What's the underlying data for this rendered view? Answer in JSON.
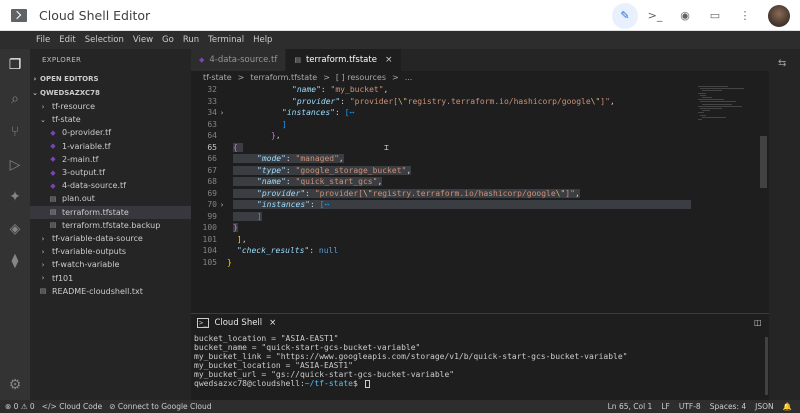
{
  "titlebar": {
    "title": "Cloud Shell Editor",
    "actions": [
      {
        "name": "edit-icon",
        "glyph": "✎"
      },
      {
        "name": "terminal-icon",
        "glyph": ">_"
      },
      {
        "name": "preview-icon",
        "glyph": "◉"
      },
      {
        "name": "layout-icon",
        "glyph": "▭"
      },
      {
        "name": "more-icon",
        "glyph": "⋮"
      }
    ]
  },
  "menubar": [
    "File",
    "Edit",
    "Selection",
    "View",
    "Go",
    "Run",
    "Terminal",
    "Help"
  ],
  "sidebar": {
    "title": "EXPLORER",
    "sections": {
      "open_editors": "OPEN EDITORS",
      "workspace": "QWEDSAZXC78"
    },
    "tree": [
      {
        "label": "tf-resource",
        "kind": "folder",
        "open": false,
        "indent": 1
      },
      {
        "label": "tf-state",
        "kind": "folder",
        "open": true,
        "indent": 1
      },
      {
        "label": "0-provider.tf",
        "kind": "tf",
        "indent": 2
      },
      {
        "label": "1-variable.tf",
        "kind": "tf",
        "indent": 2
      },
      {
        "label": "2-main.tf",
        "kind": "tf",
        "indent": 2
      },
      {
        "label": "3-output.tf",
        "kind": "tf",
        "indent": 2
      },
      {
        "label": "4-data-source.tf",
        "kind": "tf",
        "indent": 2
      },
      {
        "label": "plan.out",
        "kind": "plain",
        "indent": 2
      },
      {
        "label": "terraform.tfstate",
        "kind": "plain",
        "indent": 2,
        "selected": true
      },
      {
        "label": "terraform.tfstate.backup",
        "kind": "plain",
        "indent": 2
      },
      {
        "label": "tf-variable-data-source",
        "kind": "folder",
        "open": false,
        "indent": 1
      },
      {
        "label": "tf-variable-outputs",
        "kind": "folder",
        "open": false,
        "indent": 1
      },
      {
        "label": "tf-watch-variable",
        "kind": "folder",
        "open": false,
        "indent": 1
      },
      {
        "label": "tf101",
        "kind": "folder",
        "open": false,
        "indent": 1
      },
      {
        "label": "README-cloudshell.txt",
        "kind": "plain",
        "indent": 1
      }
    ]
  },
  "tabs": [
    {
      "label": "4-data-source.tf",
      "active": false
    },
    {
      "label": "terraform.tfstate",
      "active": true,
      "close": "×"
    }
  ],
  "breadcrumb": [
    "tf-state",
    ">",
    "terraform.tfstate",
    ">",
    "[ ] resources",
    ">",
    "..."
  ],
  "editor": {
    "lines": [
      {
        "n": "32",
        "fold": "",
        "sel": false
      },
      {
        "n": "33",
        "fold": "",
        "sel": false
      },
      {
        "n": "34",
        "fold": "›",
        "sel": false
      },
      {
        "n": "63",
        "fold": "",
        "sel": false
      },
      {
        "n": "64",
        "fold": "",
        "sel": false
      },
      {
        "n": "65",
        "fold": "",
        "sel": true,
        "current": true
      },
      {
        "n": "66",
        "fold": "",
        "sel": true
      },
      {
        "n": "67",
        "fold": "",
        "sel": true
      },
      {
        "n": "68",
        "fold": "",
        "sel": true
      },
      {
        "n": "69",
        "fold": "",
        "sel": true
      },
      {
        "n": "70",
        "fold": "›",
        "sel": true
      },
      {
        "n": "99",
        "fold": "",
        "sel": true
      },
      {
        "n": "100",
        "fold": "",
        "sel": true
      },
      {
        "n": "101",
        "fold": "",
        "sel": false
      },
      {
        "n": "104",
        "fold": "",
        "sel": false
      },
      {
        "n": "105",
        "fold": "",
        "sel": false
      }
    ],
    "text": {
      "name_key": "\"name\"",
      "name_val1": "\"my_bucket\"",
      "provider_key": "\"provider\"",
      "provider_val_a": "\"provider[",
      "provider_esc1": "\\\"",
      "provider_val_b": "registry.terraform.io/hashicorp/google",
      "provider_esc2": "\\\"",
      "provider_val_c": "]\"",
      "instances_key": "\"instances\"",
      "fold_marker": "[⋯",
      "mode_key": "\"mode\"",
      "mode_val": "\"managed\"",
      "type_key": "\"type\"",
      "type_val": "\"google_storage_bucket\"",
      "name_val2": "\"quick_start_gcs\"",
      "check_key": "\"check_results\"",
      "null_val": "null"
    }
  },
  "panel": {
    "title": "Cloud Shell",
    "close": "×",
    "split": "◫",
    "terminal_lines": [
      "bucket_location = \"ASIA-EAST1\"",
      "bucket_name = \"quick-start-gcs-bucket-variable\"",
      "my_bucket_link = \"https://www.googleapis.com/storage/v1/b/quick-start-gcs-bucket-variable\"",
      "my_bucket_location = \"ASIA-EAST1\"",
      "my_bucket_url = \"gs://quick-start-gcs-bucket-variable\""
    ],
    "prompt_user": "qwedsazxc78@cloudshell:",
    "prompt_path": "~/tf-state",
    "prompt_end": "$ "
  },
  "statusbar": {
    "problems": "⊗ 0 ⚠ 0",
    "cloud_code": "Cloud Code",
    "connect": "Connect to Google Cloud",
    "position": "Ln 65, Col 1",
    "eol": "LF",
    "encoding": "UTF-8",
    "spaces": "Spaces: 4",
    "language": "JSON",
    "bell": "🔔"
  }
}
